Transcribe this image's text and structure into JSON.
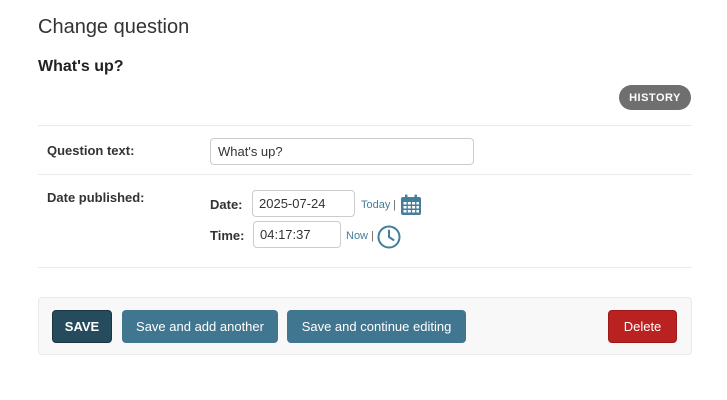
{
  "page": {
    "title": "Change question",
    "object_name": "What's up?"
  },
  "object_tools": {
    "history_label": "HISTORY"
  },
  "form": {
    "question_text": {
      "label": "Question text:",
      "value": "What's up?"
    },
    "date_published": {
      "label": "Date published:",
      "date": {
        "label": "Date:",
        "value": "2025-07-24",
        "shortcut": "Today",
        "separator": "|",
        "icon": "calendar-icon"
      },
      "time": {
        "label": "Time:",
        "value": "04:17:37",
        "shortcut": "Now",
        "separator": "|",
        "icon": "clock-icon"
      }
    }
  },
  "submit_row": {
    "save": "SAVE",
    "save_add_another": "Save and add another",
    "save_continue": "Save and continue editing",
    "delete": "Delete"
  },
  "colors": {
    "primary": "#417690",
    "primary_dark": "#264b5d",
    "delete": "#ba2121",
    "history": "#6f6f6f",
    "link": "#447e9b"
  }
}
